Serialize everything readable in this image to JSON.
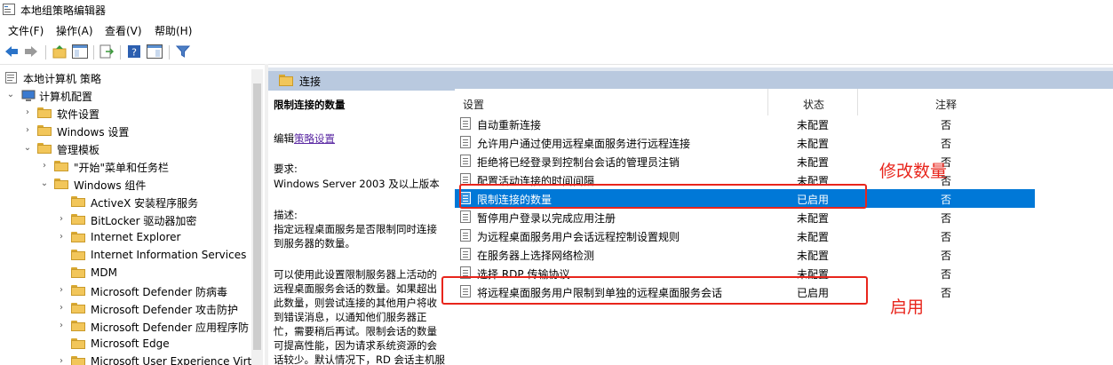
{
  "window": {
    "title": "本地组策略编辑器"
  },
  "menu": [
    "文件(F)",
    "操作(A)",
    "查看(V)",
    "帮助(H)"
  ],
  "tree": {
    "root": "本地计算机 策略",
    "computer_config": "计算机配置",
    "software": "软件设置",
    "windows_settings": "Windows 设置",
    "admin_templates": "管理模板",
    "start_menu": "\"开始\"菜单和任务栏",
    "windows_components": "Windows 组件",
    "items": [
      "ActiveX 安装程序服务",
      "BitLocker 驱动器加密",
      "Internet Explorer",
      "Internet Information Services",
      "MDM",
      "Microsoft Defender 防病毒",
      "Microsoft Defender 攻击防护",
      "Microsoft Defender 应用程序防",
      "Microsoft Edge",
      "Microsoft User Experience Virt"
    ]
  },
  "panel": {
    "header": "连接"
  },
  "description": {
    "title": "限制连接的数量",
    "edit_prefix": "编辑",
    "edit_link": "策略设置",
    "req_label": "要求:",
    "req_value": "Windows Server 2003 及以上版本",
    "desc_label": "描述:",
    "desc_lines": [
      "指定远程桌面服务是否限制同时连接",
      "到服务器的数量。"
    ],
    "more_lines": [
      "可以使用此设置限制服务器上活动的",
      "远程桌面服务会话的数量。如果超出",
      "此数量，则尝试连接的其他用户将收",
      "到错误消息，以通知他们服务器正",
      "忙，需要稍后再试。限制会话的数量",
      "可提高性能，因为请求系统资源的会",
      "话较少。默认情况下，RD 会话主机服"
    ]
  },
  "columns": {
    "setting": "设置",
    "state": "状态",
    "comment": "注释"
  },
  "rows": [
    {
      "name": "自动重新连接",
      "state": "未配置",
      "comment": "否"
    },
    {
      "name": "允许用户通过使用远程桌面服务进行远程连接",
      "state": "未配置",
      "comment": "否"
    },
    {
      "name": "拒绝将已经登录到控制台会话的管理员注销",
      "state": "未配置",
      "comment": "否"
    },
    {
      "name": "配置活动连接的时间间隔",
      "state": "未配置",
      "comment": "否"
    },
    {
      "name": "限制连接的数量",
      "state": "已启用",
      "comment": "否"
    },
    {
      "name": "暂停用户登录以完成应用注册",
      "state": "未配置",
      "comment": "否"
    },
    {
      "name": "为远程桌面服务用户会话远程控制设置规则",
      "state": "未配置",
      "comment": "否"
    },
    {
      "name": "在服务器上选择网络检测",
      "state": "未配置",
      "comment": "否"
    },
    {
      "name": "选择 RDP 传输协议",
      "state": "未配置",
      "comment": "否"
    },
    {
      "name": "将远程桌面服务用户限制到单独的远程桌面服务会话",
      "state": "已启用",
      "comment": "否"
    }
  ],
  "annotations": {
    "modify_count": "修改数量",
    "enable": "启用"
  },
  "colors": {
    "selection": "#0078d7",
    "annotation": "#e8251c",
    "panel_header": "#b9c9df"
  }
}
